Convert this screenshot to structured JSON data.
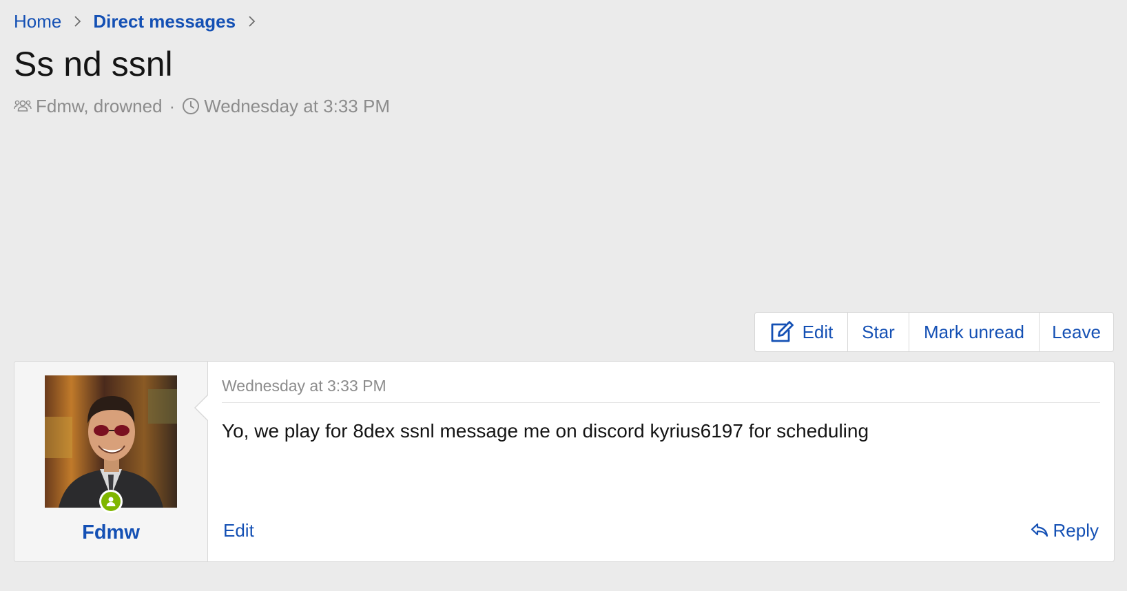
{
  "breadcrumb": {
    "home": "Home",
    "direct_messages": "Direct messages"
  },
  "conversation": {
    "title": "Ss nd ssnl",
    "participants": "Fdmw, drowned",
    "separator": "·",
    "started": "Wednesday at 3:33 PM"
  },
  "actions": {
    "edit": "Edit",
    "star": "Star",
    "mark_unread": "Mark unread",
    "leave": "Leave"
  },
  "message": {
    "author": "Fdmw",
    "date": "Wednesday at 3:33 PM",
    "body": "Yo, we play for 8dex ssnl message me on discord kyrius6197 for scheduling",
    "edit_label": "Edit",
    "reply_label": "Reply"
  },
  "icons": {
    "participants": "users-icon",
    "time": "clock-icon",
    "edit": "edit-icon",
    "reply": "reply-icon",
    "online": "online-status-icon"
  },
  "colors": {
    "link": "#1450b4",
    "online": "#7fb600",
    "muted": "#8c8c8c",
    "page_background": "#ebebeb"
  }
}
